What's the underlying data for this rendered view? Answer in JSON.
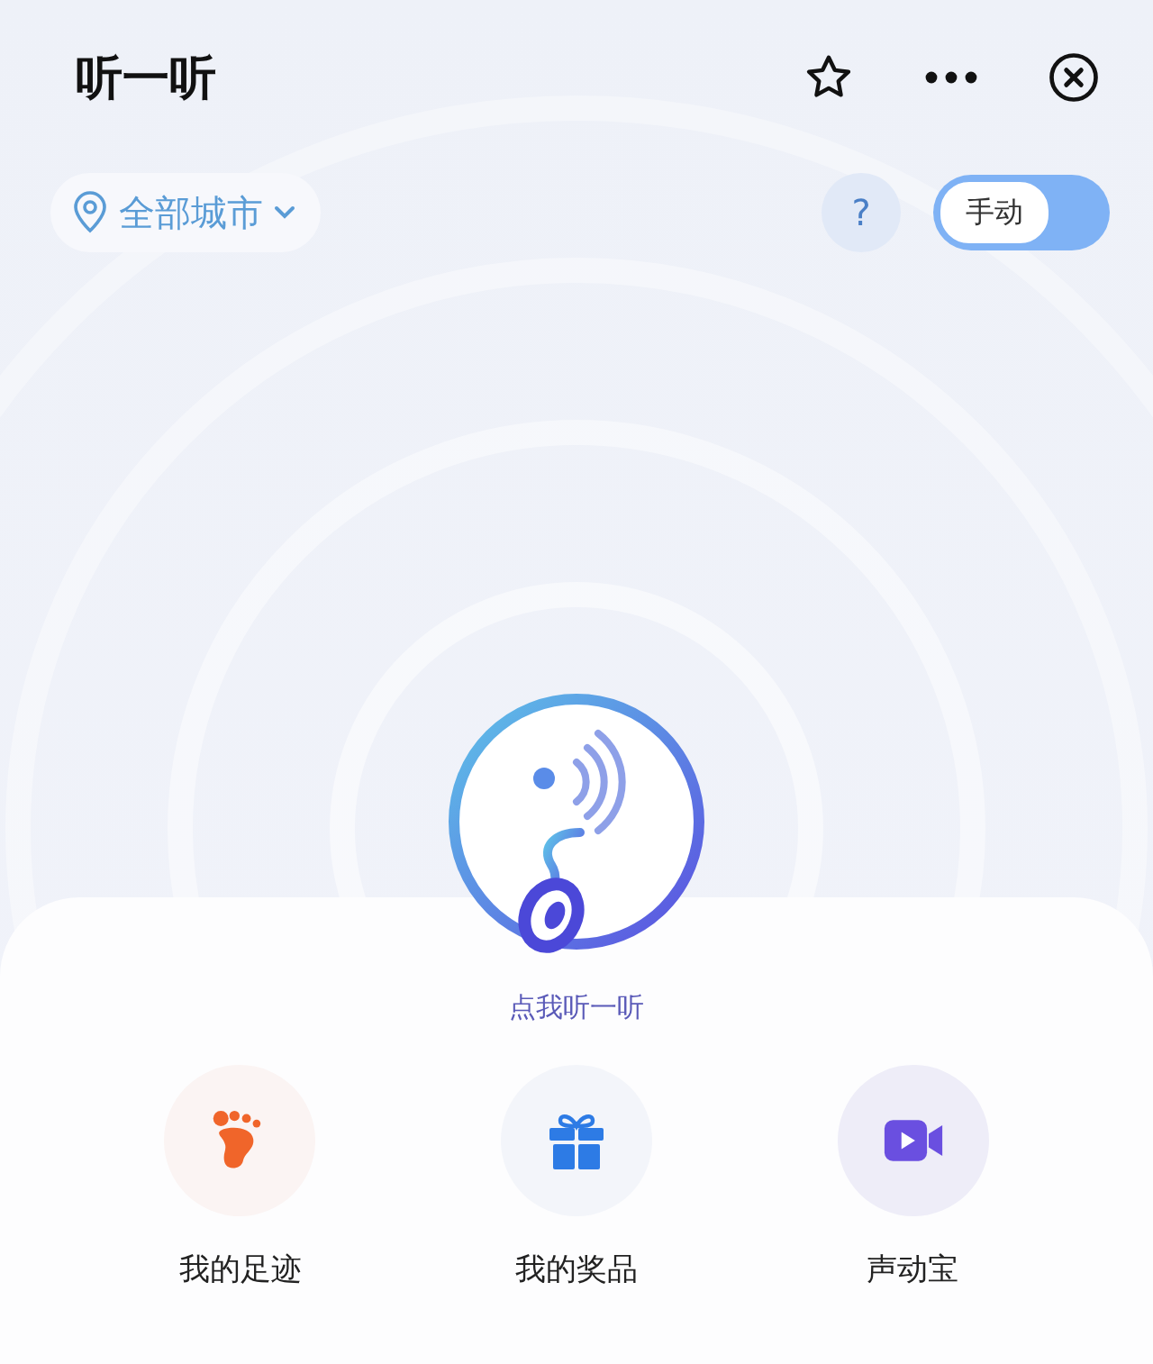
{
  "header": {
    "title": "听一听"
  },
  "location": {
    "label": "全部城市"
  },
  "help": {
    "label": "?"
  },
  "mode_toggle": {
    "label": "手动",
    "on": false
  },
  "listen_button": {
    "label": "点我听一听"
  },
  "shortcuts": [
    {
      "kind": "footprint",
      "label": "我的足迹"
    },
    {
      "kind": "gift",
      "label": "我的奖品"
    },
    {
      "kind": "video",
      "label": "声动宝"
    }
  ]
}
